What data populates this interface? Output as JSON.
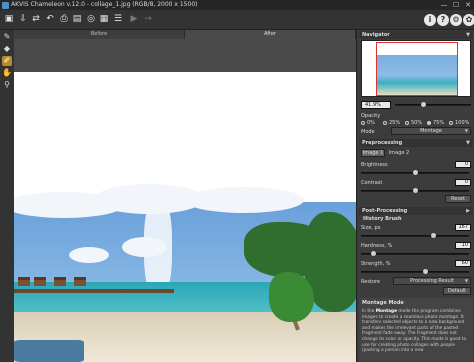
{
  "window": {
    "title": "AKVIS Chameleon v.12.0 - collage_1.jpg (RGB/8, 2000 x 1500)",
    "minimize": "—",
    "maximize": "☐",
    "close": "✕"
  },
  "toolbar": {
    "icons": [
      "open-icon",
      "save-icon",
      "swap-icon",
      "undo-icon",
      "print-icon",
      "print-alt-icon",
      "share-icon",
      "clipboard-icon",
      "batch-icon",
      "play-icon",
      "back-icon",
      "forward-icon"
    ],
    "right_icons": {
      "info": "i",
      "help": "?",
      "settings": "⚙",
      "about": "✿"
    }
  },
  "tabs": {
    "before": "Before",
    "after": "After"
  },
  "navigator": {
    "title": "Navigator",
    "zoom": "41.9%"
  },
  "opacity": {
    "label": "Opacity",
    "options": [
      "0%",
      "25%",
      "50%",
      "75%",
      "100%"
    ],
    "selected": "75%"
  },
  "mode": {
    "label": "Mode",
    "value": "Montage"
  },
  "preprocessing": {
    "title": "Preprocessing",
    "image1": "Image 1",
    "image2": "Image 2",
    "brightness_label": "Brightness",
    "brightness_value": "0",
    "contrast_label": "Contrast",
    "contrast_value": "0",
    "reset": "Reset"
  },
  "postprocessing": {
    "title": "Post-Processing",
    "history_brush": "History Brush",
    "size_label": "Size, px",
    "size_value": "167",
    "hardness_label": "Hardness, %",
    "hardness_value": "10",
    "strength_label": "Strength, %",
    "strength_value": "60",
    "restore_label": "Restore",
    "restore_value": "Processing Result",
    "default": "Default"
  },
  "help": {
    "title": "Montage Mode",
    "intro": "In the ",
    "bold": "Montage",
    "text": " mode the program combines images to create a seamless photo montage. It transfers selected objects to a new background and makes the irrelevant parts of the pasted fragment fade away. The fragment does not change its color or opacity. This mode is good to use for creating photo collages with people (pasting a person into a new"
  }
}
